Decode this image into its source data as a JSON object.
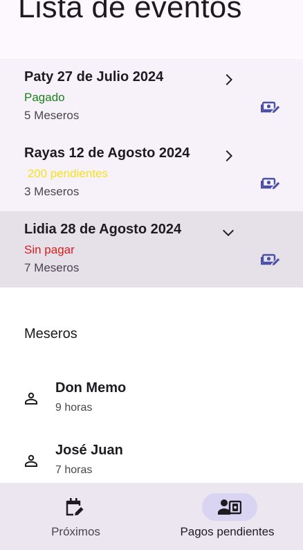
{
  "page": {
    "title": "Lista de eventos"
  },
  "events": [
    {
      "title": "Paty 27 de Julio 2024",
      "status": "Pagado",
      "status_color": "#1b7f1b",
      "waiters": "5 Meseros",
      "chevron": "chevron-right-icon",
      "expanded": false
    },
    {
      "title": "Rayas 12 de Agosto 2024",
      "status": " 200 pendientes",
      "status_color": "#f5e21f",
      "waiters": "3 Meseros",
      "chevron": "chevron-right-icon",
      "expanded": false
    },
    {
      "title": "Lidia 28 de Agosto 2024",
      "status": "Sin pagar",
      "status_color": "#d91c1c",
      "waiters": "7 Meseros",
      "chevron": "chevron-down-icon",
      "expanded": true
    }
  ],
  "waiters_section": {
    "header": "Meseros",
    "items": [
      {
        "name": "Don Memo",
        "hours": "9 horas"
      },
      {
        "name": "José Juan",
        "hours": "7 horas"
      }
    ]
  },
  "bottom_nav": {
    "items": [
      {
        "label": "Próximos",
        "icon": "calendar-edit-icon",
        "active": false
      },
      {
        "label": "Pagos pendientes",
        "icon": "payment-account-icon",
        "active": true
      }
    ]
  },
  "colors": {
    "accent": "#4a4fa8",
    "indicator": "#d9d4f2",
    "expanded_card": "#e6e0e9"
  }
}
